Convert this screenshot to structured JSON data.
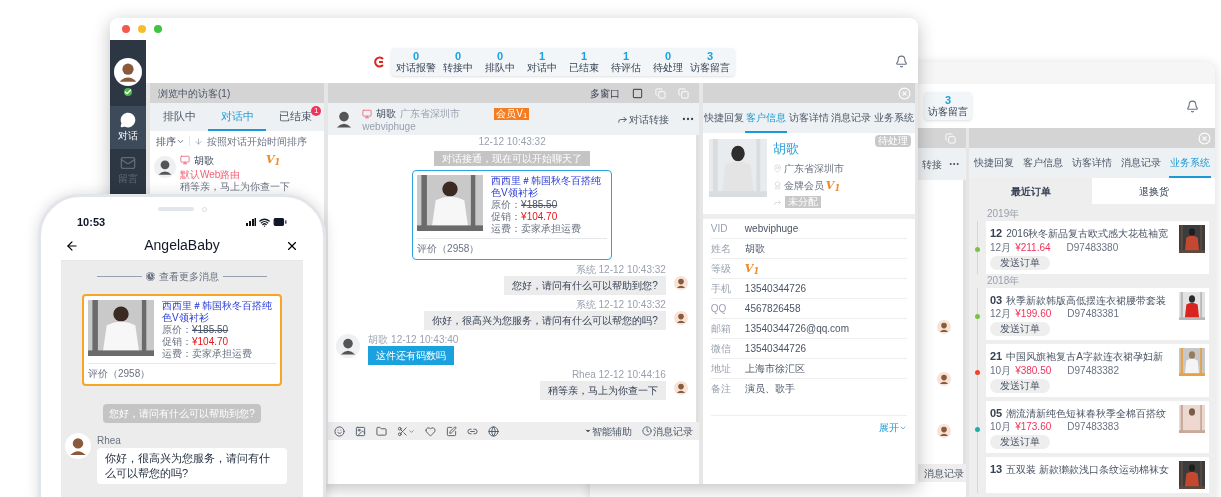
{
  "main_window": {
    "sidebar": {
      "items": [
        {
          "label": "对话",
          "selected": true
        },
        {
          "label": "留言",
          "selected": false
        }
      ]
    },
    "stats": [
      {
        "value": "0",
        "label": "对话报警"
      },
      {
        "value": "0",
        "label": "转接中"
      },
      {
        "value": "0",
        "label": "排队中"
      },
      {
        "value": "1",
        "label": "对话中"
      },
      {
        "value": "1",
        "label": "已结束"
      },
      {
        "value": "1",
        "label": "待评估"
      },
      {
        "value": "0",
        "label": "待处理"
      },
      {
        "value": "3",
        "label": "访客留言"
      }
    ],
    "visitor_panel": {
      "title": "浏览中的访客(1)",
      "tabs": [
        {
          "label": "排队中",
          "selected": false
        },
        {
          "label": "对话中",
          "selected": true
        },
        {
          "label": "已结束",
          "selected": false,
          "badge": "1"
        }
      ],
      "sort": {
        "label": "排序",
        "hint": "按照对话开始时间排序"
      },
      "visitors": [
        {
          "name": "胡歌",
          "grade": "V$_{1}$",
          "route": "默认Web路由",
          "last_message": "稍等亲，马上为你查一下"
        }
      ]
    },
    "chat": {
      "title": "多窗口",
      "visitor": {
        "name": "胡歌",
        "location": "广东省深圳市",
        "badge": "会员V$_{1}$",
        "id": "webviphuge"
      },
      "transfer": "对话转接",
      "messages": [
        {
          "kind": "time",
          "text": "12-12 10:43:32"
        },
        {
          "kind": "notice",
          "text": "对话接通，现在可以开始聊天了"
        },
        {
          "kind": "product",
          "title": "西西里＃韩国秋冬百搭纯色V领衬衫",
          "price_label": "原价：",
          "price": "¥185.50",
          "sale_label": "促销：",
          "sale": "¥104.70",
          "shipping_label": "运费：",
          "shipping": "卖家承担运费",
          "reviews": "评价（2958）"
        },
        {
          "kind": "agent",
          "meta": "系统 12-12 10:43:32",
          "text": "您好，请问有什么可以帮助到您?"
        },
        {
          "kind": "agent",
          "meta": "系统 12-12 10:43:32",
          "text": "你好，很高兴为您服务，请问有什么可以帮您的吗?"
        },
        {
          "kind": "visitor",
          "meta": "胡歌 12-12 10:43:40",
          "text": "这件还有码数吗"
        },
        {
          "kind": "agent",
          "meta": "Rhea 12-12 10:44:16",
          "text": "稍等亲，马上为你查一下"
        }
      ],
      "assist": "智能辅助",
      "history": "消息记录"
    },
    "info_panel": {
      "tabs": [
        {
          "label": "快捷回复",
          "selected": false
        },
        {
          "label": "客户信息",
          "selected": true
        },
        {
          "label": "访客详情",
          "selected": false
        },
        {
          "label": "消息记录",
          "selected": false
        },
        {
          "label": "业务系统",
          "selected": false
        }
      ],
      "profile": {
        "name": "胡歌",
        "location": "广东省深圳市",
        "membership": "金牌会员",
        "grade": "V$_{1}$",
        "assignment": "未分配",
        "status": "待处理"
      },
      "fields": [
        {
          "kind": "text",
          "label": "VID",
          "value": "webviphuge"
        },
        {
          "kind": "text",
          "label": "姓名",
          "value": "胡歌"
        },
        {
          "kind": "grade",
          "label": "等级",
          "value": "V$_{1}$"
        },
        {
          "kind": "text",
          "label": "手机",
          "value": "13540344726"
        },
        {
          "kind": "text",
          "label": "QQ",
          "value": "4567826458"
        },
        {
          "kind": "text",
          "label": "邮箱",
          "value": "13540344726@qq.com"
        },
        {
          "kind": "text",
          "label": "微信",
          "value": "13540344726"
        },
        {
          "kind": "text",
          "label": "地址",
          "value": "上海市徐汇区"
        },
        {
          "kind": "note",
          "label": "备注",
          "value": "演员、歌手"
        }
      ],
      "expand": "展开"
    }
  },
  "back_window": {
    "stat": {
      "value": "3",
      "label": "访客留言"
    },
    "chat": {
      "transfer": "转接",
      "history": "消息记录"
    },
    "panel": {
      "tabs": [
        {
          "label": "快捷回复",
          "selected": false
        },
        {
          "label": "客户信息",
          "selected": false
        },
        {
          "label": "访客详情",
          "selected": false
        },
        {
          "label": "消息记录",
          "selected": false
        },
        {
          "label": "业务系统",
          "selected": true
        }
      ],
      "subtabs": [
        {
          "label": "最近订单",
          "selected": true
        },
        {
          "label": "退换货",
          "selected": false
        }
      ],
      "groups": [
        {
          "year": "2019年",
          "orders": [
            {
              "day": "12",
              "title": "2016秋冬新品复古欧式感大花苞袖宽",
              "month": "12月",
              "price": "¥211.64",
              "order_no": "D97483380",
              "button": "发送订单",
              "color": "#7cc242"
            }
          ]
        },
        {
          "year": "2018年",
          "orders": [
            {
              "day": "03",
              "title": "秋季新款韩版高低摆连衣裙腰带套装",
              "month": "12月",
              "price": "¥199.60",
              "order_no": "D97483381",
              "button": "发送订单",
              "color": "#7cc242"
            },
            {
              "day": "21",
              "title": "中国风旗袍复古A字款连衣裙孕妇新",
              "month": "10月",
              "price": "¥380.50",
              "order_no": "D97483382",
              "button": "发送订单",
              "color": "#f0432b"
            },
            {
              "day": "05",
              "title": "潮流清新纯色短袜春秋季全棉百搭纹",
              "month": "10月",
              "price": "¥173.60",
              "order_no": "D97483383",
              "button": "发送订单",
              "color": "#19b0a8"
            },
            {
              "day": "13",
              "title": "五双装 新款獺款浅口条纹运动棉袜女"
            }
          ]
        }
      ]
    }
  },
  "phone": {
    "time": "10:53",
    "title": "AngelaBaby",
    "more": "查看更多消息",
    "product": {
      "title": "西西里＃韩国秋冬百搭纯色V领衬衫",
      "price_label": "原价：",
      "price": "¥185.50",
      "sale_label": "促销：",
      "sale": "¥104.70",
      "shipping_label": "运费：",
      "shipping": "卖家承担运费",
      "reviews": "评价（2958）"
    },
    "notice": "您好，请问有什么可以帮助到您?",
    "reply": {
      "name": "Rhea",
      "text": "你好，很高兴为您服务，请问有什么可以帮您的吗?"
    }
  }
}
